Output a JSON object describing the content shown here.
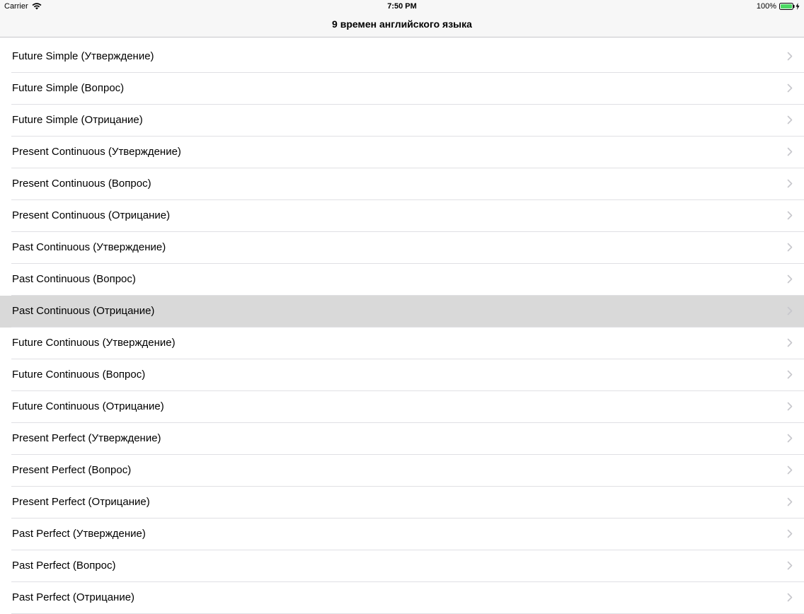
{
  "status_bar": {
    "carrier": "Carrier",
    "time": "7:50 PM",
    "battery": "100%"
  },
  "nav": {
    "title": "9 времен английского языка"
  },
  "list": {
    "items": [
      {
        "label": "Future Simple (Утверждение)"
      },
      {
        "label": "Future Simple (Вопрос)"
      },
      {
        "label": "Future Simple (Отрицание)"
      },
      {
        "label": "Present Continuous (Утверждение)"
      },
      {
        "label": "Present Continuous (Вопрос)"
      },
      {
        "label": "Present Continuous (Отрицание)"
      },
      {
        "label": "Past Continuous (Утверждение)"
      },
      {
        "label": "Past Continuous (Вопрос)"
      },
      {
        "label": "Past Continuous (Отрицание)"
      },
      {
        "label": "Future Continuous (Утверждение)"
      },
      {
        "label": "Future Continuous (Вопрос)"
      },
      {
        "label": "Future Continuous (Отрицание)"
      },
      {
        "label": "Present Perfect (Утверждение)"
      },
      {
        "label": "Present Perfect (Вопрос)"
      },
      {
        "label": "Present Perfect (Отрицание)"
      },
      {
        "label": "Past Perfect (Утверждение)"
      },
      {
        "label": "Past Perfect (Вопрос)"
      },
      {
        "label": "Past Perfect (Отрицание)"
      }
    ],
    "selected_index": 8
  },
  "icons": {
    "status": [
      "wifi-icon",
      "battery-icon",
      "charging-bolt-icon"
    ],
    "row_accessory": "chevron-right-icon"
  },
  "colors": {
    "selected_row": "#d9d9d9",
    "battery_fill": "#4cd964",
    "chevron": "#c7c7cc",
    "separator": "#e0e0e4"
  }
}
